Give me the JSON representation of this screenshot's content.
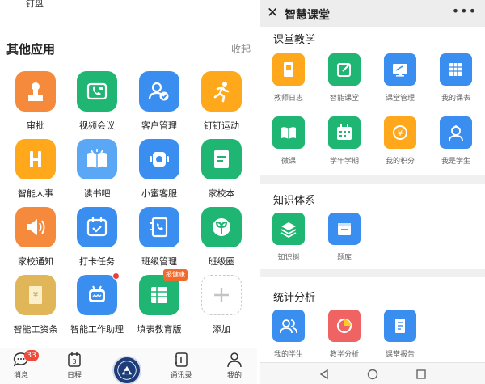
{
  "left": {
    "top_partial_label": "钉盘",
    "section_title": "其他应用",
    "collapse_label": "收起",
    "apps": [
      {
        "label": "审批",
        "icon": "stamp-icon",
        "color": "#f58a3c"
      },
      {
        "label": "视频会议",
        "icon": "video-call-icon",
        "color": "#1fb573"
      },
      {
        "label": "客户管理",
        "icon": "customer-icon",
        "color": "#3a8ef0"
      },
      {
        "label": "钉钉运动",
        "icon": "running-icon",
        "color": "#ffa81b"
      },
      {
        "label": "智能人事",
        "icon": "hr-icon",
        "color": "#ffa81b"
      },
      {
        "label": "读书吧",
        "icon": "book-icon",
        "color": "#5aa7f5"
      },
      {
        "label": "小蜜客服",
        "icon": "customer-service-icon",
        "color": "#3a8ef0"
      },
      {
        "label": "家校本",
        "icon": "notebook-icon",
        "color": "#1fb573"
      },
      {
        "label": "家校通知",
        "icon": "speaker-icon",
        "color": "#f58a3c"
      },
      {
        "label": "打卡任务",
        "icon": "calendar-check-icon",
        "color": "#3a8ef0"
      },
      {
        "label": "班级管理",
        "icon": "class-manage-icon",
        "color": "#3a8ef0"
      },
      {
        "label": "班级圈",
        "icon": "leaf-icon",
        "color": "#1fb573"
      },
      {
        "label": "智能工资条",
        "icon": "payslip-icon",
        "color": "#e0b659"
      },
      {
        "label": "智能工作助理",
        "icon": "robot-icon",
        "color": "#3a8ef0"
      },
      {
        "label": "填表教育版",
        "icon": "form-icon",
        "color": "#1fb573",
        "badge": "报健康"
      },
      {
        "label": "添加",
        "icon": "plus-icon",
        "color": "#ffffff"
      }
    ],
    "tabs": [
      {
        "label": "消息",
        "icon": "chat-icon",
        "badge": "33"
      },
      {
        "label": "日程",
        "icon": "calendar-icon",
        "day": "3"
      },
      {
        "label": "",
        "icon": "school-logo-icon"
      },
      {
        "label": "通讯录",
        "icon": "contacts-icon"
      },
      {
        "label": "我的",
        "icon": "profile-icon"
      }
    ]
  },
  "right": {
    "title": "智慧课堂",
    "close_icon": "close-icon",
    "more_icon": "more-icon",
    "sections": [
      {
        "title": "课堂教学",
        "apps": [
          {
            "label": "教师日志",
            "icon": "teacher-log-icon",
            "color": "#ffa81b"
          },
          {
            "label": "智能课堂",
            "icon": "smart-class-icon",
            "color": "#1fb573"
          },
          {
            "label": "课堂管理",
            "icon": "monitor-icon",
            "color": "#3a8ef0"
          },
          {
            "label": "我的课表",
            "icon": "timetable-icon",
            "color": "#3a8ef0"
          },
          {
            "label": "微课",
            "icon": "open-book-icon",
            "color": "#1fb573"
          },
          {
            "label": "学年学期",
            "icon": "calendar-icon",
            "color": "#1fb573"
          },
          {
            "label": "我的积分",
            "icon": "points-icon",
            "color": "#ffa81b"
          },
          {
            "label": "我是学生",
            "icon": "student-icon",
            "color": "#3a8ef0"
          }
        ]
      },
      {
        "title": "知识体系",
        "apps": [
          {
            "label": "知识树",
            "icon": "layers-icon",
            "color": "#1fb573"
          },
          {
            "label": "题库",
            "icon": "question-bank-icon",
            "color": "#3a8ef0"
          }
        ]
      },
      {
        "title": "统计分析",
        "apps": [
          {
            "label": "我的学生",
            "icon": "students-icon",
            "color": "#3a8ef0"
          },
          {
            "label": "教学分析",
            "icon": "pie-icon",
            "color": "#f06363"
          },
          {
            "label": "课堂报告",
            "icon": "report-icon",
            "color": "#3a8ef0"
          }
        ]
      }
    ],
    "android_nav": [
      "back-icon",
      "home-icon",
      "recents-icon"
    ]
  }
}
